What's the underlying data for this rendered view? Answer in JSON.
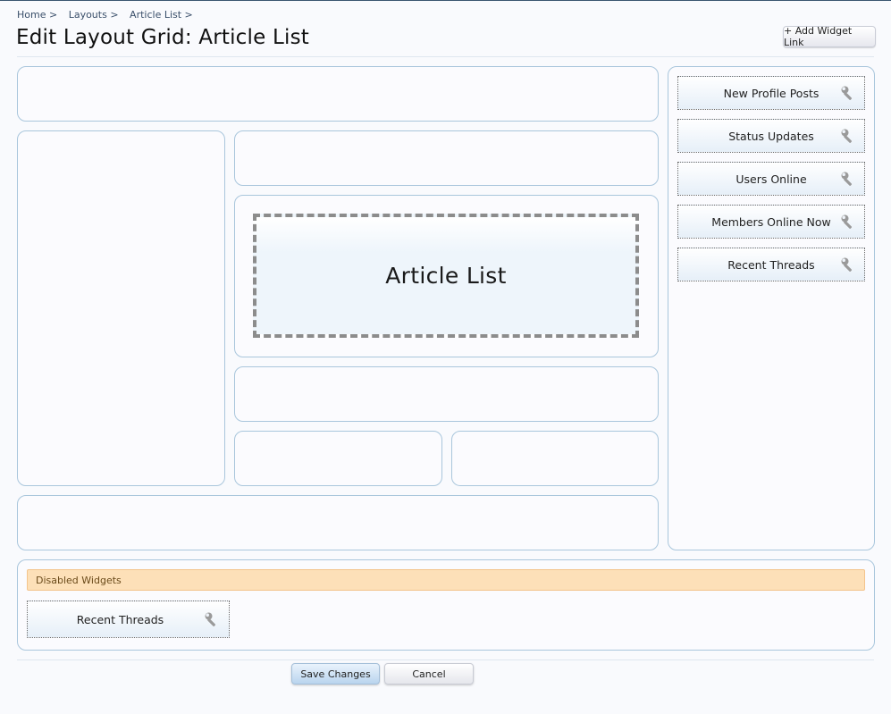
{
  "breadcrumb": [
    "Home >",
    "Layouts >",
    "Article List >"
  ],
  "page_title": "Edit Layout Grid: Article List",
  "add_widget_link_label": "+ Add Widget Link",
  "main_content_label": "Article List",
  "sidebar_widgets": [
    "New Profile Posts",
    "Status Updates",
    "Users Online",
    "Members Online Now",
    "Recent Threads"
  ],
  "disabled_section": {
    "header": "Disabled Widgets",
    "widgets": [
      "Recent Threads"
    ]
  },
  "buttons": {
    "save": "Save Changes",
    "cancel": "Cancel"
  },
  "icons": {
    "widget_options": "wrench-icon"
  }
}
